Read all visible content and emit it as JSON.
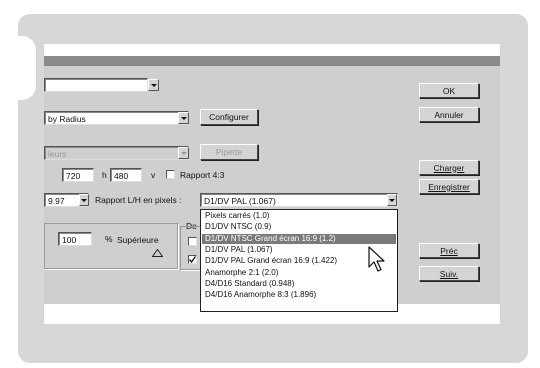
{
  "dialog": {
    "row1_value": "",
    "row2_value": "by Radius",
    "configurer_label": "Configurer",
    "row3_value": "leurs",
    "pipette_label": "Pipette",
    "width_value": "720",
    "h_label": "h",
    "height_value": "480",
    "v_label": "v",
    "rapport43_label": "Rapport 4:3",
    "resolution_value": "9.97",
    "rapport_lh_label": "Rapport L/H en pixels :",
    "rapport_lh_selected": "D1/DV PAL (1.067)",
    "scale_value": "100",
    "percent_label": "%",
    "superieure_label": "Supérieure",
    "de_label": "De",
    "buttons": {
      "ok": "OK",
      "annuler": "Annuler",
      "charger": "Charger",
      "enregistrer": "Enregistrer",
      "prec": "Préc",
      "suiv": "Suiv."
    }
  },
  "pixel_aspect_options": [
    "Pixels carrés (1.0)",
    "D1/DV NTSC (0.9)",
    "D1/DV NTSC Grand écran 16:9 (1.2)",
    "D1/DV PAL (1.067)",
    "D1/DV PAL Grand écran 16:9 (1.422)",
    "Anamorphe 2:1 (2.0)",
    "D4/D16 Standard (0.948)",
    "D4/D16 Anamorphe 8:3 (1.896)"
  ],
  "highlighted_option_index": 2
}
